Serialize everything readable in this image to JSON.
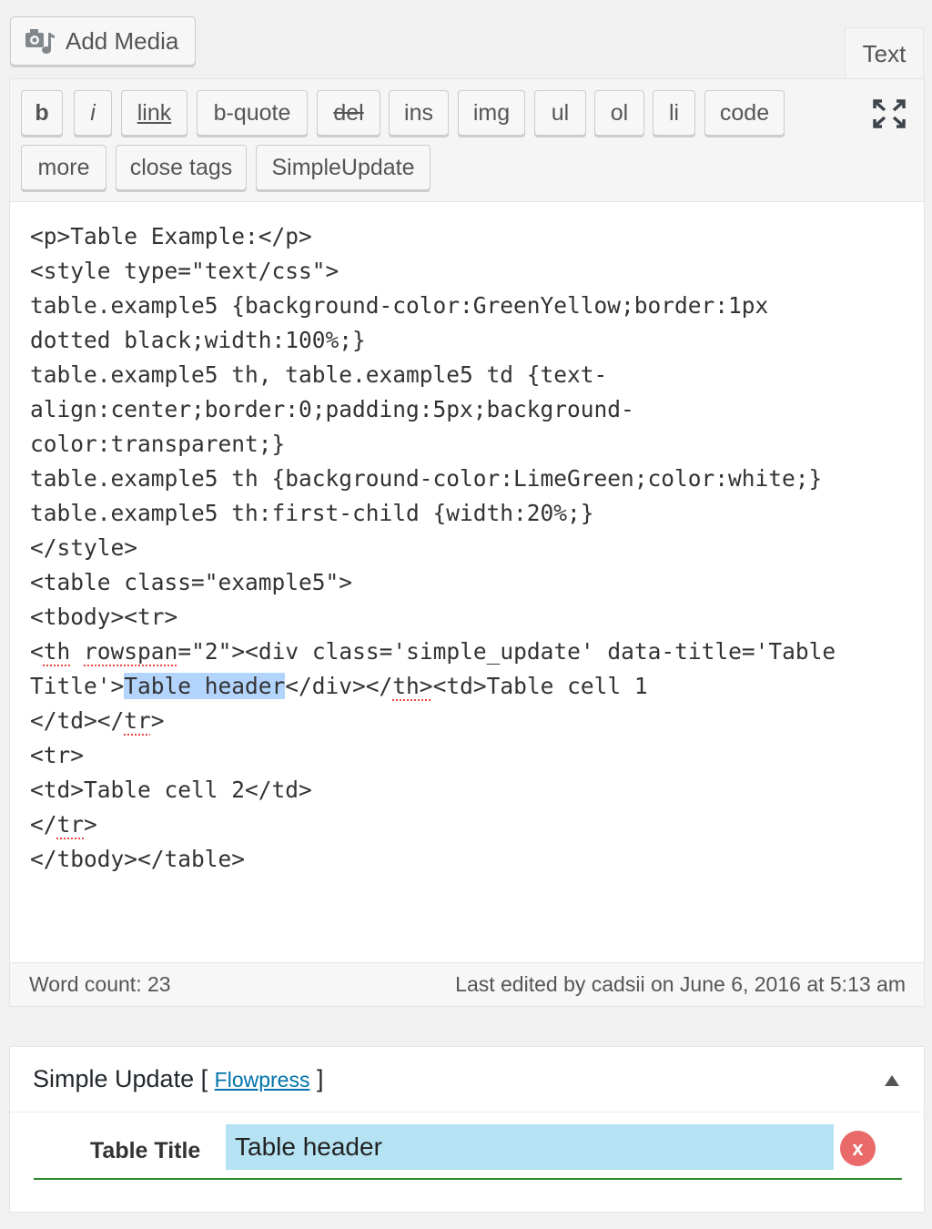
{
  "media": {
    "add_media_label": "Add Media",
    "icon": "camera-music-icon"
  },
  "editor_tabs": {
    "text_label": "Text"
  },
  "toolbar": {
    "buttons": [
      "b",
      "i",
      "link",
      "b-quote",
      "del",
      "ins",
      "img",
      "ul",
      "ol",
      "li",
      "code",
      "more",
      "close tags",
      "SimpleUpdate"
    ],
    "fullscreen_icon": "fullscreen-icon"
  },
  "code_lines": [
    "<p>Table Example:</p>",
    "<style type=\"text/css\">",
    "table.example5 {background-color:GreenYellow;border:1px",
    "dotted black;width:100%;}",
    "table.example5 th, table.example5 td {text-",
    "align:center;border:0;padding:5px;background-",
    "color:transparent;}",
    "table.example5 th {background-color:LimeGreen;color:white;}",
    "table.example5 th:first-child {width:20%;}",
    "</style>",
    "<table class=\"example5\">",
    "<tbody><tr>",
    "<th rowspan=\"2\"><div class='simple_update' data-title='Table",
    "Title'>Table header</div></th><td>Table cell 1",
    "</td></tr>",
    "<tr>",
    "<td>Table cell 2</td>",
    "</tr>",
    "</tbody></table>"
  ],
  "status": {
    "word_count": "Word count: 23",
    "last_edited": "Last edited by cadsii on June 6, 2016 at 5:13 am"
  },
  "simple_update": {
    "title": "Simple Update",
    "bracket_open": "[",
    "link_label": "Flowpress",
    "bracket_close": "]",
    "field_label": "Table Title",
    "field_value": "Table header",
    "clear_label": "x"
  },
  "colors": {
    "field_bg": "#b6e3f3",
    "clear_button": "#ea6a6a",
    "underline": "#2d8a2d",
    "link": "#0073aa",
    "selection": "#b3d4fc"
  }
}
